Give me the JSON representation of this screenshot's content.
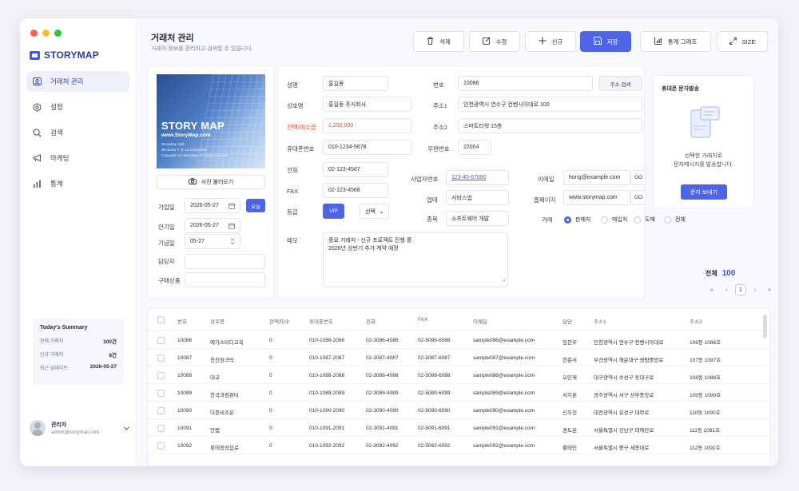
{
  "window": {
    "controls": {
      "close": "#ff5f57",
      "minimize": "#febc2e",
      "maximize": "#28c840"
    }
  },
  "app": {
    "logo": "STORYMAP",
    "accent": "#4d63e8"
  },
  "sidebar": {
    "items": [
      {
        "label": "거래처 관리",
        "icon": "users-icon",
        "active": true
      },
      {
        "label": "설정",
        "icon": "gear-icon",
        "active": false
      },
      {
        "label": "검색",
        "icon": "search-icon",
        "active": false
      },
      {
        "label": "마케팅",
        "icon": "megaphone-icon",
        "active": false
      },
      {
        "label": "통계",
        "icon": "bar-chart-icon",
        "active": false
      }
    ],
    "summary": {
      "title": "Today's Summary",
      "rows": [
        {
          "label": "전체 거래처",
          "value": "100건"
        },
        {
          "label": "신규 거래처",
          "value": "8건"
        },
        {
          "label": "최근 업데이트",
          "value": "2026-05-27"
        }
      ]
    },
    "user": {
      "name": "관리자",
      "email": "admin@storymap.com"
    }
  },
  "header": {
    "title": "거래처 관리",
    "subtitle": "거래처 정보를 관리하고 검색할 수 있습니다."
  },
  "toolbar": {
    "delete": "삭제",
    "edit": "수정",
    "new": "신규",
    "save": "저장",
    "chart": "통계 그래프",
    "size": "SIZE"
  },
  "photo": {
    "title": "STORY MAP",
    "url": "www.StoryMap.com",
    "line1": "StoryMap Soft",
    "line2": "Windows 7, 8, 10 compatible",
    "line3": "Copyright (c) StoryMap All rights reserved",
    "button": "사진 불러오기"
  },
  "dates": {
    "join_label": "가입일",
    "join": "2026-05-27",
    "today": "오늘",
    "expire_label": "만기일",
    "expire": "2026-05-27",
    "anniv_label": "기념일",
    "anniv": "05-27",
    "manager_label": "담당자",
    "manager": "",
    "product_label": "구매상품",
    "product": ""
  },
  "form": {
    "name_label": "성명",
    "name": "홍길동",
    "company_label": "상호명",
    "company": "홍길동 주식회사",
    "balance_label": "잔액/미수금",
    "balance": "1,250,000",
    "mobile_label": "휴대폰번호",
    "mobile": "010-1234-5678",
    "phone_label": "전화",
    "phone": "02-123-4567",
    "fax_label": "FAX",
    "fax": "02-123-4568",
    "grade_label": "등급",
    "grade": "VIP",
    "grade_select": "선택",
    "memo_label": "메모",
    "memo_line1": "중요 거래처 - 신규 프로젝트 진행 중",
    "memo_line2": "2026년 상반기 추가 계약 예정",
    "no_label": "번호",
    "no": "10086",
    "addr_search": "주소 검색",
    "addr1_label": "주소1",
    "addr1": "인천광역시 연수구 컨벤시아대로 100",
    "addr2_label": "주소2",
    "addr2": "스마트타워 15층",
    "zip_label": "우편번호",
    "zip": "22004",
    "biz_label": "사업자번호",
    "biz": "123-45-67890",
    "type_label": "업태",
    "type": "서비스업",
    "item_label": "종목",
    "item": "소프트웨어 개발",
    "email_label": "이메일",
    "email": "hong@example.com",
    "go": "GO",
    "home_label": "홈페이지",
    "home": "www.storymap.com",
    "trade_label": "거래",
    "trade_options": [
      "판매처",
      "매입처",
      "도매",
      "전체"
    ],
    "trade_selected": "판매처"
  },
  "sms": {
    "title": "휴대폰 문자발송",
    "text1": "선택한 거래처로",
    "text2": "문자메시지를 발송합니다.",
    "button": "문자 보내기"
  },
  "pagination": {
    "total_label": "전체",
    "total": "100",
    "first": "«",
    "prev": "‹",
    "page": "1",
    "next": "›",
    "last": "»"
  },
  "table": {
    "columns": [
      "번호",
      "상호명",
      "잔액/미수",
      "휴대폰번호",
      "전화",
      "FAX",
      "이메일",
      "담당",
      "주소1",
      "주소2"
    ],
    "rows": [
      [
        "10086",
        "에가스터디교육",
        "0",
        "010-1086-2086",
        "02-3086-4086",
        "02-5086-6086",
        "sample086@example.com",
        "임건우",
        "인천광역시 연수구 컨벤시아대로",
        "106동 1086호"
      ],
      [
        "10087",
        "옹진원크빅",
        "0",
        "010-1087-2087",
        "02-3087-4087",
        "02-5087-6087",
        "sample087@example.com",
        "한준서",
        "부산광역시 해운대구 센텀중앙로",
        "107동 1087호"
      ],
      [
        "10088",
        "대교",
        "0",
        "010-1088-2088",
        "02-3088-4088",
        "02-5088-6088",
        "sample088@example.com",
        "오민재",
        "대구광역시 수성구 동대구로",
        "108동 1088호"
      ],
      [
        "10089",
        "한국과컴퓨터",
        "0",
        "010-1089-2089",
        "02-3089-4089",
        "02-5089-6089",
        "sample089@example.com",
        "서지훈",
        "광주광역시 서구 상무중앙로",
        "109동 1089호"
      ],
      [
        "10090",
        "더존비즈온",
        "0",
        "010-1090-2090",
        "02-3090-4090",
        "02-5090-6090",
        "sample090@example.com",
        "신우진",
        "대전광역시 유성구 대학로",
        "110동 1090호"
      ],
      [
        "10091",
        "안랩",
        "0",
        "010-1091-2091",
        "02-3091-4091",
        "02-5091-6091",
        "sample091@example.com",
        "권도윤",
        "서울특별시 강남구 테헤란로",
        "111동 1091호"
      ],
      [
        "10092",
        "롯데정성음료",
        "0",
        "010-1092-2092",
        "02-3092-4092",
        "02-5092-6092",
        "sample092@example.com",
        "황태인",
        "서울특별시 중구 세종대로",
        "112동 1092호"
      ]
    ]
  }
}
